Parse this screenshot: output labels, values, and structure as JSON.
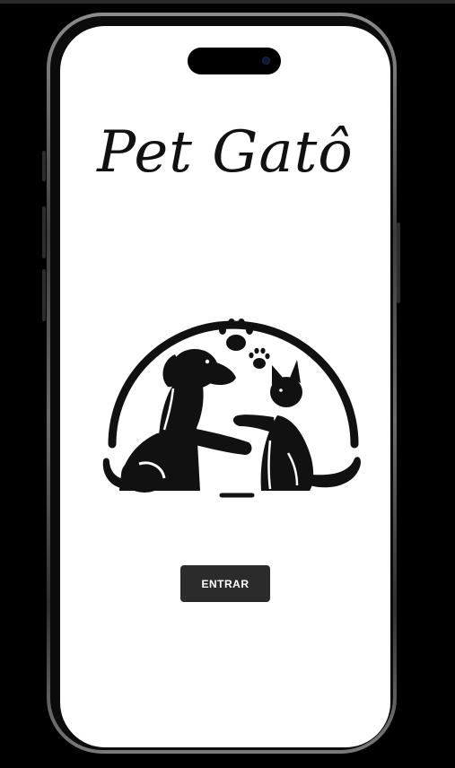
{
  "app": {
    "title": "Pet Gatô"
  },
  "logo": {
    "icon": "dog-and-cat-playing-icon"
  },
  "actions": {
    "enter_label": "ENTRAR"
  }
}
